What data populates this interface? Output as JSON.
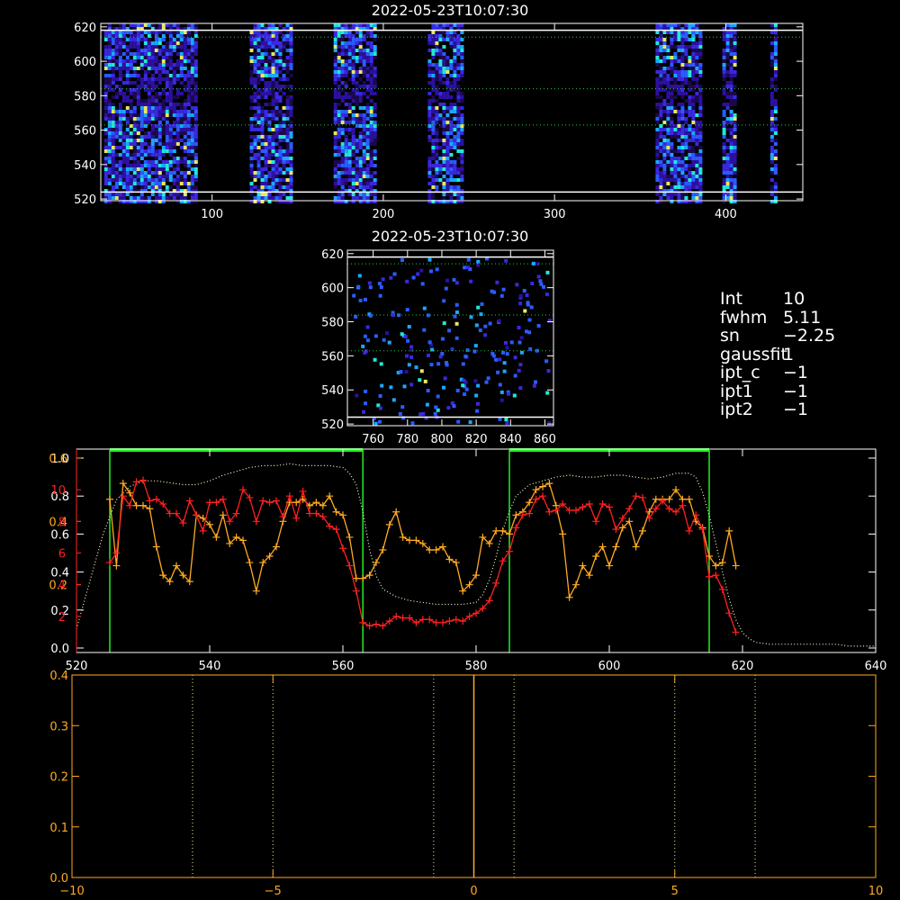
{
  "colors": {
    "axes": "#ffffff",
    "orange": "#ffaa22",
    "red": "#ff2020",
    "green": "#22ee22",
    "guide": "#eeee99",
    "profile": "#eeffcc"
  },
  "params": [
    {
      "key": "Int",
      "value": "10"
    },
    {
      "key": "fwhm",
      "value": "5.11"
    },
    {
      "key": "sn",
      "value": "−2.25"
    },
    {
      "key": "gaussfit",
      "value": "1"
    },
    {
      "key": "ipt_c",
      "value": "−1"
    },
    {
      "key": "ipt1",
      "value": "−1"
    },
    {
      "key": "ipt2",
      "value": "−1"
    }
  ],
  "chart_data": [
    {
      "type": "heatmap",
      "title": "2022-05-23T10:07:30",
      "xlim": [
        35,
        445
      ],
      "ylim": [
        519,
        622
      ],
      "xticks": [
        100,
        200,
        300,
        400
      ],
      "yticks": [
        520,
        540,
        560,
        580,
        600,
        620
      ],
      "colormap": "dark-blue-to-cyan-yellow",
      "active_columns": [
        [
          37,
          90
        ],
        [
          122,
          147
        ],
        [
          171,
          196
        ],
        [
          226,
          246
        ],
        [
          359,
          385
        ],
        [
          398,
          406
        ],
        [
          426,
          429
        ]
      ],
      "gap_rows": [
        [
          575,
          592
        ]
      ],
      "hlines_solid": [
        524,
        618
      ],
      "hlines_dotted": [
        584,
        563,
        614
      ]
    },
    {
      "type": "heatmap",
      "title": "2022-05-23T10:07:30",
      "xlim": [
        745,
        865
      ],
      "ylim": [
        519,
        622
      ],
      "xticks": [
        760,
        780,
        800,
        820,
        840,
        860
      ],
      "yticks": [
        520,
        540,
        560,
        580,
        600,
        620
      ],
      "colormap": "sparse-blue-cyan",
      "hlines_solid": [
        524,
        618
      ],
      "hlines_dotted": [
        584,
        563,
        614
      ]
    },
    {
      "type": "line",
      "xlim": [
        520,
        640
      ],
      "xticks": [
        520,
        540,
        560,
        580,
        600,
        620,
        640
      ],
      "left_axis_white": {
        "ylim": [
          0,
          1.0
        ],
        "tick_labels": [
          "0.0",
          "0.2",
          "0.4",
          "0.6",
          "0.8",
          "1.0"
        ]
      },
      "left_axis_orange": {
        "ylim": [
          0,
          0.6
        ],
        "tick_labels": [
          "0.2",
          "0.4",
          "0.6"
        ]
      },
      "left_axis_red": {
        "ylim": [
          0,
          12
        ],
        "tick_labels": [
          "2",
          "4",
          "6",
          "8",
          "10"
        ]
      },
      "green_windows": [
        [
          525,
          563
        ],
        [
          585,
          615
        ]
      ],
      "green_top_level": 0.95,
      "series": [
        {
          "role": "profile",
          "axis": "white",
          "color": "profile",
          "style": "dotted",
          "x": [
            520,
            522,
            524,
            526,
            528,
            530,
            532,
            534,
            536,
            538,
            540,
            542,
            544,
            546,
            548,
            550,
            552,
            554,
            556,
            558,
            560,
            561,
            562,
            563,
            564,
            565,
            566,
            568,
            570,
            572,
            574,
            576,
            578,
            580,
            581,
            582,
            583,
            584,
            585,
            586,
            588,
            590,
            592,
            594,
            596,
            598,
            600,
            602,
            604,
            606,
            608,
            610,
            612,
            613,
            614,
            615,
            616,
            617,
            618,
            619,
            620,
            621,
            622,
            624,
            626,
            628,
            630,
            632,
            634,
            636,
            638,
            640
          ],
          "y": [
            0.1,
            0.35,
            0.6,
            0.78,
            0.85,
            0.88,
            0.88,
            0.87,
            0.86,
            0.86,
            0.88,
            0.91,
            0.93,
            0.95,
            0.96,
            0.96,
            0.97,
            0.96,
            0.96,
            0.96,
            0.95,
            0.92,
            0.86,
            0.72,
            0.52,
            0.38,
            0.31,
            0.27,
            0.25,
            0.24,
            0.23,
            0.23,
            0.23,
            0.24,
            0.28,
            0.36,
            0.48,
            0.62,
            0.72,
            0.8,
            0.86,
            0.88,
            0.9,
            0.91,
            0.9,
            0.9,
            0.91,
            0.91,
            0.9,
            0.89,
            0.9,
            0.92,
            0.92,
            0.9,
            0.82,
            0.7,
            0.55,
            0.4,
            0.26,
            0.15,
            0.08,
            0.05,
            0.03,
            0.02,
            0.02,
            0.02,
            0.02,
            0.02,
            0.02,
            0.01,
            0.01,
            0.01
          ]
        },
        {
          "role": "orange",
          "axis": "orange",
          "color": "orange",
          "x": [
            525,
            526,
            527,
            528,
            529,
            530,
            531,
            532,
            533,
            534,
            535,
            536,
            537,
            538,
            539,
            540,
            541,
            542,
            543,
            544,
            545,
            546,
            547,
            548,
            549,
            550,
            551,
            552,
            553,
            554,
            555,
            556,
            557,
            558,
            559,
            560,
            561,
            562,
            563,
            564,
            565,
            566,
            567,
            568,
            569,
            570,
            571,
            572,
            573,
            574,
            575,
            576,
            577,
            578,
            579,
            580,
            581,
            582,
            583,
            584,
            585,
            586,
            587,
            588,
            589,
            590,
            591,
            592,
            593,
            594,
            595,
            596,
            597,
            598,
            599,
            600,
            601,
            602,
            603,
            604,
            605,
            606,
            607,
            608,
            609,
            610,
            611,
            612,
            613,
            614,
            615,
            616,
            617,
            618,
            619
          ],
          "y": [
            0.47,
            0.26,
            0.52,
            0.49,
            0.45,
            0.45,
            0.44,
            0.32,
            0.23,
            0.21,
            0.26,
            0.23,
            0.21,
            0.42,
            0.41,
            0.39,
            0.35,
            0.42,
            0.33,
            0.35,
            0.34,
            0.27,
            0.18,
            0.27,
            0.29,
            0.32,
            0.4,
            0.46,
            0.46,
            0.47,
            0.45,
            0.46,
            0.45,
            0.48,
            0.43,
            0.42,
            0.35,
            0.22,
            0.22,
            0.23,
            0.27,
            0.31,
            0.39,
            0.43,
            0.35,
            0.34,
            0.34,
            0.33,
            0.31,
            0.31,
            0.32,
            0.28,
            0.27,
            0.18,
            0.2,
            0.23,
            0.35,
            0.33,
            0.37,
            0.37,
            0.36,
            0.42,
            0.43,
            0.46,
            0.5,
            0.51,
            0.52,
            0.45,
            0.36,
            0.16,
            0.2,
            0.26,
            0.23,
            0.29,
            0.32,
            0.26,
            0.32,
            0.38,
            0.4,
            0.32,
            0.37,
            0.43,
            0.47,
            0.47,
            0.47,
            0.5,
            0.47,
            0.47,
            0.4,
            0.38,
            0.29,
            0.26,
            0.27,
            0.37,
            0.26
          ]
        },
        {
          "role": "red",
          "axis": "red",
          "color": "red",
          "x": [
            525,
            526,
            527,
            528,
            529,
            530,
            531,
            532,
            533,
            534,
            535,
            536,
            537,
            538,
            539,
            540,
            541,
            542,
            543,
            544,
            545,
            546,
            547,
            548,
            549,
            550,
            551,
            552,
            553,
            554,
            555,
            556,
            557,
            558,
            559,
            560,
            561,
            562,
            563,
            564,
            565,
            566,
            567,
            568,
            569,
            570,
            571,
            572,
            573,
            574,
            575,
            576,
            577,
            578,
            579,
            580,
            581,
            582,
            583,
            584,
            585,
            586,
            587,
            588,
            589,
            590,
            591,
            592,
            593,
            594,
            595,
            596,
            597,
            598,
            599,
            600,
            601,
            602,
            603,
            604,
            605,
            606,
            607,
            608,
            609,
            610,
            611,
            612,
            613,
            614,
            615,
            616,
            617,
            618,
            619
          ],
          "y": [
            5.4,
            6.0,
            9.6,
            9.0,
            10.5,
            10.6,
            9.3,
            9.4,
            9.1,
            8.5,
            8.5,
            7.9,
            9.3,
            8.4,
            7.4,
            9.2,
            9.2,
            9.4,
            8.0,
            8.5,
            10.0,
            9.5,
            8.0,
            9.3,
            9.2,
            9.3,
            8.3,
            9.6,
            8.2,
            9.9,
            8.5,
            8.5,
            8.3,
            7.7,
            7.5,
            6.3,
            5.2,
            3.6,
            1.6,
            1.4,
            1.5,
            1.4,
            1.7,
            2.0,
            1.9,
            1.9,
            1.6,
            1.8,
            1.8,
            1.6,
            1.6,
            1.7,
            1.8,
            1.7,
            2.0,
            2.2,
            2.5,
            3.0,
            4.1,
            5.5,
            6.1,
            7.6,
            8.4,
            8.5,
            9.4,
            9.6,
            8.6,
            8.7,
            9.1,
            8.7,
            8.7,
            8.9,
            9.1,
            8.0,
            9.1,
            8.9,
            7.5,
            8.2,
            8.8,
            9.6,
            9.5,
            8.2,
            8.8,
            9.3,
            8.8,
            8.6,
            9.0,
            7.4,
            8.4,
            7.5,
            4.5,
            4.6,
            3.7,
            2.2,
            1.0
          ]
        }
      ]
    },
    {
      "type": "line",
      "xlim": [
        -10,
        10
      ],
      "ylim": [
        0,
        0.4
      ],
      "xticks": [
        -10,
        -5,
        0,
        5,
        10
      ],
      "x_tick_labels": [
        "−10",
        "−5",
        "0",
        "5",
        "10"
      ],
      "y_tick_labels": [
        "0.0",
        "0.1",
        "0.2",
        "0.3",
        "0.4"
      ],
      "vlines_dotted": [
        -7,
        -5,
        -1,
        1,
        5,
        7
      ],
      "vline_solid": 0
    }
  ]
}
